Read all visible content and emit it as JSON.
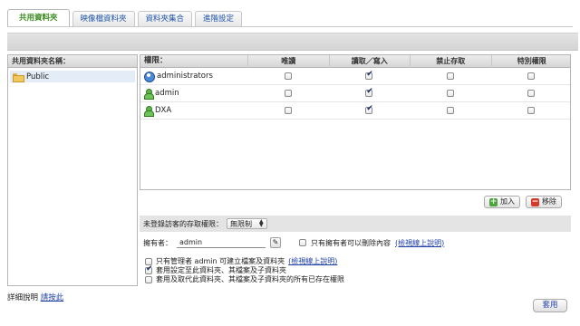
{
  "tabs": [
    {
      "label": "共用資料夾",
      "active": true
    },
    {
      "label": "映像檔資料夾",
      "active": false
    },
    {
      "label": "資料夾集合",
      "active": false
    },
    {
      "label": "進階設定",
      "active": false
    }
  ],
  "folder_panel": {
    "header": "共用資料夾名稱：",
    "items": [
      {
        "label": "Public",
        "selected": true
      }
    ]
  },
  "permissions_table": {
    "columns": [
      "權限：",
      "唯讀",
      "讀取／寫入",
      "禁止存取",
      "特別權限"
    ],
    "rows": [
      {
        "name": "administrators",
        "icon": "group-icon",
        "read_only": false,
        "read_write": true,
        "deny": false,
        "special": false
      },
      {
        "name": "admin",
        "icon": "user-icon",
        "read_only": false,
        "read_write": true,
        "deny": false,
        "special": false
      },
      {
        "name": "DXA",
        "icon": "user-icon",
        "read_only": false,
        "read_write": true,
        "deny": false,
        "special": false
      }
    ]
  },
  "buttons": {
    "add": "加入",
    "remove": "移除",
    "apply": "套用"
  },
  "guest_access": {
    "label": "未登錄訪客的存取權限：",
    "value": "無限制"
  },
  "owner": {
    "label": "擁有者：",
    "value": "admin",
    "only_owner_delete": "只有擁有者可以刪除內容",
    "only_owner_delete_checked": false,
    "online_help": "(檢視線上說明)"
  },
  "options": [
    {
      "text": "只有管理者 admin 可建立檔案及資料夾",
      "link": "(檢視線上說明)",
      "checked": false
    },
    {
      "text": "套用設定至此資料夾、其檔案及子資料夾",
      "link": "",
      "checked": true
    },
    {
      "text": "套用及取代此資料夾、其檔案及子資料夾的所有已存在權限",
      "link": "",
      "checked": false
    }
  ],
  "footer": {
    "detail_label": "詳細說明",
    "detail_link": "請按此"
  }
}
